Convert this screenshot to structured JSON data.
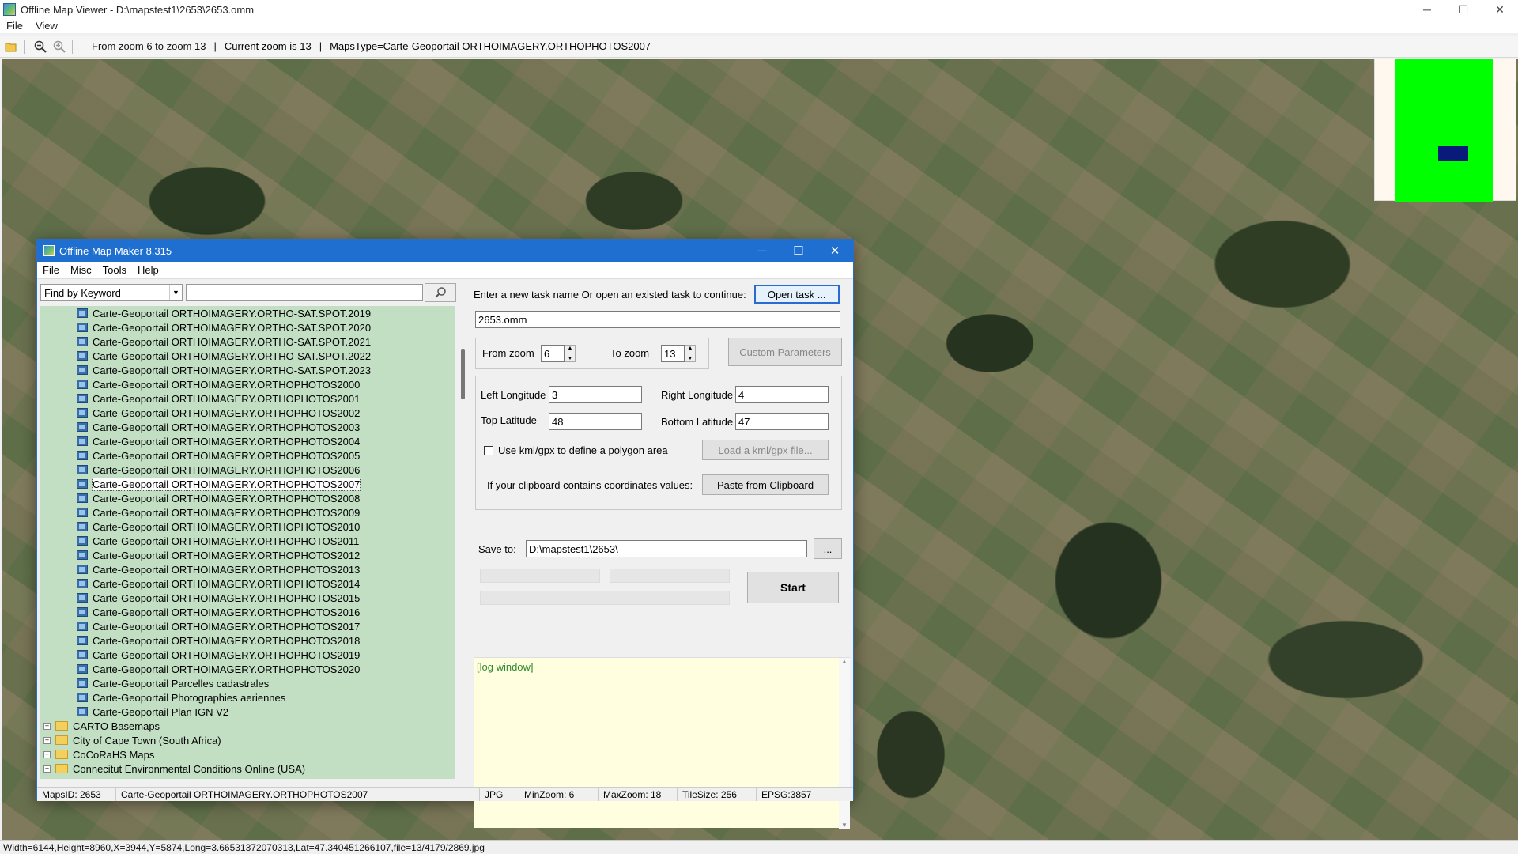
{
  "window": {
    "title": "Offline Map Viewer - D:\\mapstest1\\2653\\2653.omm",
    "menu": [
      "File",
      "View"
    ],
    "controls": {
      "minimize": "─",
      "maximize": "☐",
      "close": "✕"
    }
  },
  "toolbar": {
    "zoom_range": "From zoom 6 to zoom 13",
    "current_zoom": "Current zoom is 13",
    "maps_type": "MapsType=Carte-Geoportail ORTHOIMAGERY.ORTHOPHOTOS2007",
    "divider": "|"
  },
  "statusbar": {
    "text": "Width=6144,Height=8960,X=3944,Y=5874,Long=3.66531372070313,Lat=47.340451266107,file=13/4179/2869.jpg"
  },
  "dialog": {
    "title": "Offline Map Maker 8.315",
    "menu": [
      "File",
      "Misc",
      "Tools",
      "Help"
    ],
    "controls": {
      "minimize": "─",
      "maximize": "☐",
      "close": "✕"
    },
    "search": {
      "mode": "Find by Keyword",
      "query": ""
    },
    "tree": {
      "leaves": [
        "Carte-Geoportail ORTHOIMAGERY.ORTHO-SAT.SPOT.2019",
        "Carte-Geoportail ORTHOIMAGERY.ORTHO-SAT.SPOT.2020",
        "Carte-Geoportail ORTHOIMAGERY.ORTHO-SAT.SPOT.2021",
        "Carte-Geoportail ORTHOIMAGERY.ORTHO-SAT.SPOT.2022",
        "Carte-Geoportail ORTHOIMAGERY.ORTHO-SAT.SPOT.2023",
        "Carte-Geoportail ORTHOIMAGERY.ORTHOPHOTOS2000",
        "Carte-Geoportail ORTHOIMAGERY.ORTHOPHOTOS2001",
        "Carte-Geoportail ORTHOIMAGERY.ORTHOPHOTOS2002",
        "Carte-Geoportail ORTHOIMAGERY.ORTHOPHOTOS2003",
        "Carte-Geoportail ORTHOIMAGERY.ORTHOPHOTOS2004",
        "Carte-Geoportail ORTHOIMAGERY.ORTHOPHOTOS2005",
        "Carte-Geoportail ORTHOIMAGERY.ORTHOPHOTOS2006",
        "Carte-Geoportail ORTHOIMAGERY.ORTHOPHOTOS2007",
        "Carte-Geoportail ORTHOIMAGERY.ORTHOPHOTOS2008",
        "Carte-Geoportail ORTHOIMAGERY.ORTHOPHOTOS2009",
        "Carte-Geoportail ORTHOIMAGERY.ORTHOPHOTOS2010",
        "Carte-Geoportail ORTHOIMAGERY.ORTHOPHOTOS2011",
        "Carte-Geoportail ORTHOIMAGERY.ORTHOPHOTOS2012",
        "Carte-Geoportail ORTHOIMAGERY.ORTHOPHOTOS2013",
        "Carte-Geoportail ORTHOIMAGERY.ORTHOPHOTOS2014",
        "Carte-Geoportail ORTHOIMAGERY.ORTHOPHOTOS2015",
        "Carte-Geoportail ORTHOIMAGERY.ORTHOPHOTOS2016",
        "Carte-Geoportail ORTHOIMAGERY.ORTHOPHOTOS2017",
        "Carte-Geoportail ORTHOIMAGERY.ORTHOPHOTOS2018",
        "Carte-Geoportail ORTHOIMAGERY.ORTHOPHOTOS2019",
        "Carte-Geoportail ORTHOIMAGERY.ORTHOPHOTOS2020",
        "Carte-Geoportail Parcelles cadastrales",
        "Carte-Geoportail Photographies aeriennes",
        "Carte-Geoportail Plan IGN V2"
      ],
      "selected_leaf": "Carte-Geoportail ORTHOIMAGERY.ORTHOPHOTOS2007",
      "folders": [
        "CARTO Basemaps",
        "City of Cape Town (South Africa)",
        "CoCoRaHS Maps",
        "Connecitut Environmental Conditions Online (USA)"
      ]
    },
    "task": {
      "prompt": "Enter a new task name Or open an existed task to continue:",
      "open_button": "Open task ...",
      "name": "2653.omm"
    },
    "zoom": {
      "from_label": "From zoom",
      "from_value": "6",
      "to_label": "To zoom",
      "to_value": "13",
      "custom_button": "Custom Parameters"
    },
    "bounds": {
      "left_label": "Left Longitude",
      "left_value": "3",
      "right_label": "Right Longitude",
      "right_value": "4",
      "top_label": "Top Latitude",
      "top_value": "48",
      "bottom_label": "Bottom Latitude",
      "bottom_value": "47",
      "kml_label": "Use kml/gpx to define a polygon area",
      "kml_button": "Load a kml/gpx file...",
      "clipboard_label": "If your clipboard contains coordinates values:",
      "clipboard_button": "Paste from Clipboard"
    },
    "save": {
      "label": "Save to:",
      "path": "D:\\mapstest1\\2653\\",
      "browse": "..."
    },
    "start_button": "Start",
    "log": "[log window]",
    "status": {
      "maps_id": "MapsID: 2653",
      "map_name": "Carte-Geoportail ORTHOIMAGERY.ORTHOPHOTOS2007",
      "format": "JPG",
      "min_zoom": "MinZoom: 6",
      "max_zoom": "MaxZoom: 18",
      "tile_size": "TileSize: 256",
      "epsg": "EPSG:3857"
    }
  },
  "colors": {
    "tree_bg": "#c2dfc4",
    "dialog_title": "#1f6fd1",
    "log_bg": "#ffffe0",
    "minimap_green": "#00ff00",
    "minimap_rect": "#0a1a7a"
  },
  "icons": [
    "open-folder-icon",
    "zoom-out-icon",
    "zoom-in-icon",
    "search-icon",
    "map-layer-icon",
    "folder-icon",
    "expand-icon"
  ]
}
